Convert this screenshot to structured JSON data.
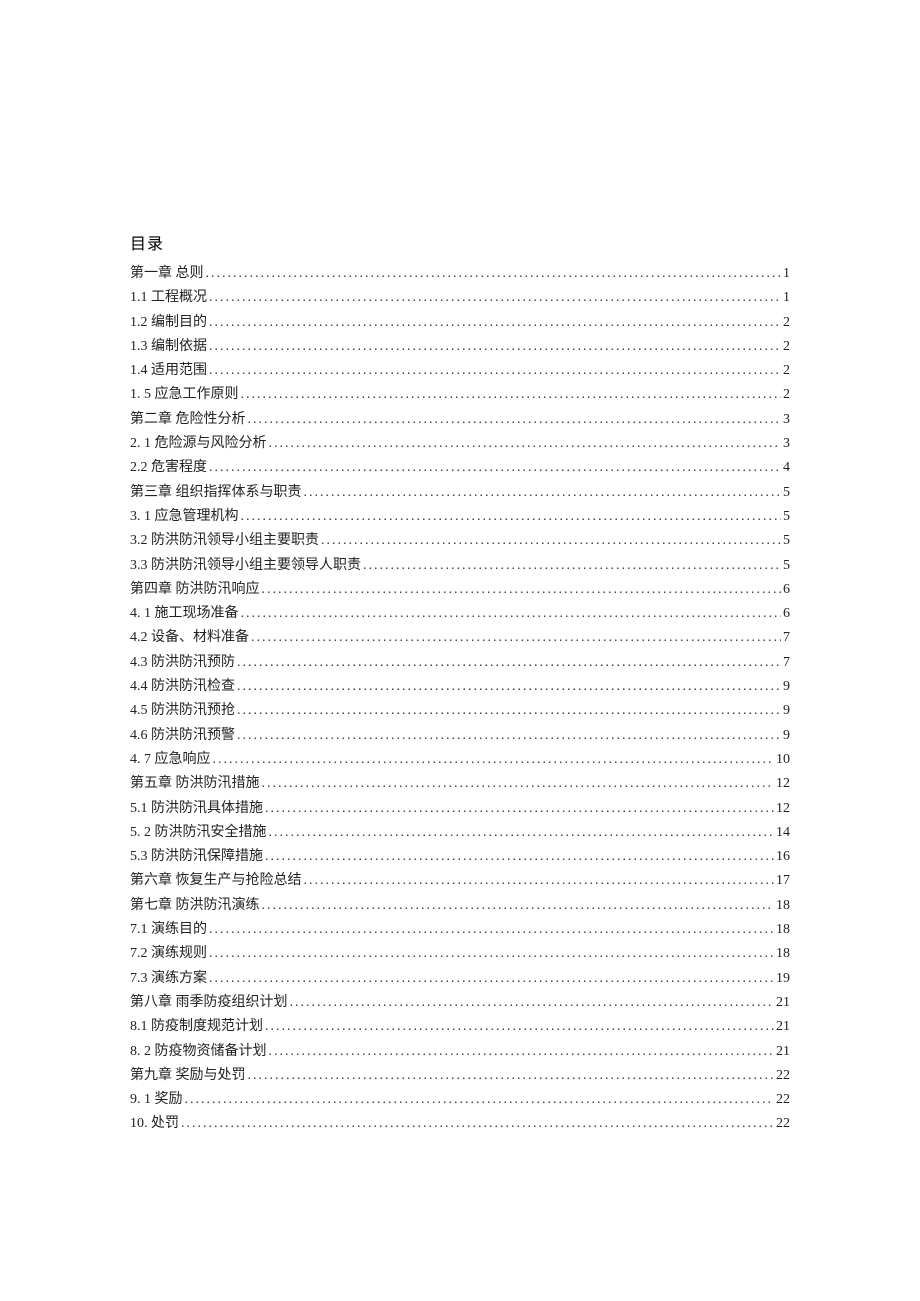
{
  "title": "目录",
  "entries": [
    {
      "label": "第一章 总则",
      "page": "1"
    },
    {
      "label": "1.1 工程概况",
      "page": "1"
    },
    {
      "label": "1.2 编制目的",
      "page": "2"
    },
    {
      "label": "1.3 编制依据",
      "page": "2"
    },
    {
      "label": "1.4 适用范围",
      "page": "2"
    },
    {
      "label": "1.   5 应急工作原则",
      "page": "2"
    },
    {
      "label": "第二章 危险性分析",
      "page": "3"
    },
    {
      "label": "2.   1 危险源与风险分析",
      "page": "3"
    },
    {
      "label": "2.2 危害程度",
      "page": "4"
    },
    {
      "label": "第三章 组织指挥体系与职责",
      "page": "5"
    },
    {
      "label": "3.   1 应急管理机构",
      "page": "5"
    },
    {
      "label": "3.2     防洪防汛领导小组主要职责",
      "page": "5"
    },
    {
      "label": "3.3     防洪防汛领导小组主要领导人职责",
      "page": "5"
    },
    {
      "label": "第四章 防洪防汛响应",
      "page": "6"
    },
    {
      "label": "4.   1 施工现场准备",
      "page": "6"
    },
    {
      "label": "4.2     设备、材料准备",
      "page": "7"
    },
    {
      "label": "4.3     防洪防汛预防",
      "page": "7"
    },
    {
      "label": "4.4     防洪防汛检查",
      "page": "9"
    },
    {
      "label": "4.5     防洪防汛预抢",
      "page": "9"
    },
    {
      "label": "4.6     防洪防汛预警",
      "page": "9"
    },
    {
      "label": "4.   7 应急响应",
      "page": "10"
    },
    {
      "label": "第五章 防洪防汛措施",
      "page": "12"
    },
    {
      "label": "5.1 防洪防汛具体措施",
      "page": "12"
    },
    {
      "label": "5.   2 防洪防汛安全措施",
      "page": "14"
    },
    {
      "label": "5.3 防洪防汛保障措施",
      "page": "16"
    },
    {
      "label": "第六章 恢复生产与抢险总结",
      "page": "17"
    },
    {
      "label": "第七章 防洪防汛演练",
      "page": "18"
    },
    {
      "label": "7.1 演练目的",
      "page": "18"
    },
    {
      "label": "7.2 演练规则",
      "page": "18"
    },
    {
      "label": "7.3 演练方案",
      "page": "19"
    },
    {
      "label": "第八章 雨季防疫组织计划",
      "page": "21"
    },
    {
      "label": "8.1 防疫制度规范计划",
      "page": "21"
    },
    {
      "label": "8.   2 防疫物资储备计划",
      "page": "21"
    },
    {
      "label": "第九章 奖励与处罚",
      "page": "22"
    },
    {
      "label": "9.   1 奖励",
      "page": "22"
    },
    {
      "label": "10.   处罚",
      "page": "22"
    }
  ]
}
